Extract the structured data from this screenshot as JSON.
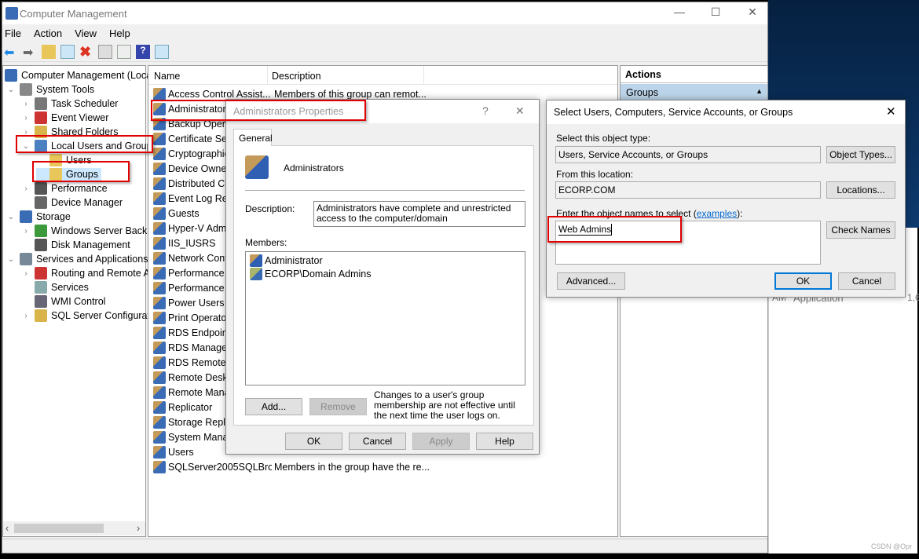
{
  "window": {
    "title": "Computer Management",
    "minimize": "—",
    "maximize": "☐",
    "close": "✕"
  },
  "menu": [
    "File",
    "Action",
    "View",
    "Help"
  ],
  "toolbar_icons": [
    "back-icon",
    "forward-icon",
    "up-folder-icon",
    "show-hide-tree-icon",
    "delete-icon",
    "properties-icon",
    "export-list-icon",
    "help-icon",
    "show-hide-action-pane-icon"
  ],
  "tree": [
    {
      "label": "Computer Management (Local",
      "level": 0,
      "expander": ""
    },
    {
      "label": "System Tools",
      "level": 1,
      "expander": "⌄"
    },
    {
      "label": "Task Scheduler",
      "level": 2,
      "expander": "›"
    },
    {
      "label": "Event Viewer",
      "level": 2,
      "expander": "›"
    },
    {
      "label": "Shared Folders",
      "level": 2,
      "expander": "›"
    },
    {
      "label": "Local Users and Groups",
      "level": 2,
      "expander": "⌄"
    },
    {
      "label": "Users",
      "level": 3,
      "expander": ""
    },
    {
      "label": "Groups",
      "level": 3,
      "expander": ""
    },
    {
      "label": "Performance",
      "level": 2,
      "expander": "›"
    },
    {
      "label": "Device Manager",
      "level": 2,
      "expander": ""
    },
    {
      "label": "Storage",
      "level": 1,
      "expander": "⌄"
    },
    {
      "label": "Windows Server Backup",
      "level": 2,
      "expander": "›"
    },
    {
      "label": "Disk Management",
      "level": 2,
      "expander": ""
    },
    {
      "label": "Services and Applications",
      "level": 1,
      "expander": "⌄"
    },
    {
      "label": "Routing and Remote Ac",
      "level": 2,
      "expander": "›"
    },
    {
      "label": "Services",
      "level": 2,
      "expander": ""
    },
    {
      "label": "WMI Control",
      "level": 2,
      "expander": ""
    },
    {
      "label": "SQL Server Configuratio",
      "level": 2,
      "expander": "›"
    }
  ],
  "list": {
    "columns": [
      "Name",
      "Description"
    ],
    "rows": [
      {
        "name": "Access Control Assist...",
        "desc": "Members of this group can remot..."
      },
      {
        "name": "Administrators",
        "desc": ""
      },
      {
        "name": "Backup Opera",
        "desc": ""
      },
      {
        "name": "Certificate Serv",
        "desc": ""
      },
      {
        "name": "Cryptographic",
        "desc": ""
      },
      {
        "name": "Device Owners",
        "desc": ""
      },
      {
        "name": "Distributed CO",
        "desc": ""
      },
      {
        "name": "Event Log Rea",
        "desc": ""
      },
      {
        "name": "Guests",
        "desc": ""
      },
      {
        "name": "Hyper-V Admi",
        "desc": ""
      },
      {
        "name": "IIS_IUSRS",
        "desc": ""
      },
      {
        "name": "Network Confi",
        "desc": ""
      },
      {
        "name": "Performance L",
        "desc": ""
      },
      {
        "name": "Performance M",
        "desc": ""
      },
      {
        "name": "Power Users",
        "desc": ""
      },
      {
        "name": "Print Operator",
        "desc": ""
      },
      {
        "name": "RDS Endpoint",
        "desc": ""
      },
      {
        "name": "RDS Managem",
        "desc": ""
      },
      {
        "name": "RDS Remote A",
        "desc": ""
      },
      {
        "name": "Remote Deskto",
        "desc": ""
      },
      {
        "name": "Remote Manag",
        "desc": ""
      },
      {
        "name": "Replicator",
        "desc": ""
      },
      {
        "name": "Storage Replic",
        "desc": ""
      },
      {
        "name": "System Manag",
        "desc": ""
      },
      {
        "name": "Users",
        "desc": ""
      },
      {
        "name": "SQLServer2005SQLBro...",
        "desc": "Members in the group have the re..."
      }
    ]
  },
  "actions": {
    "header": "Actions",
    "section": "Groups"
  },
  "background_window": {
    "col1": "AM",
    "col2": "Application",
    "col3": "1,6"
  },
  "properties_dialog": {
    "title": "Administrators Properties",
    "help": "?",
    "close": "✕",
    "tab": "General",
    "group_name": "Administrators",
    "description_label": "Description:",
    "description": "Administrators have complete and unrestricted access to the computer/domain",
    "members_label": "Members:",
    "members": [
      "Administrator",
      "ECORP\\Domain Admins"
    ],
    "add": "Add...",
    "remove": "Remove",
    "note": "Changes to a user's group membership are not effective until the next time the user logs on.",
    "ok": "OK",
    "cancel": "Cancel",
    "apply": "Apply",
    "help_btn": "Help"
  },
  "select_dialog": {
    "title": "Select Users, Computers, Service Accounts, or Groups",
    "close": "✕",
    "object_type_label": "Select this object type:",
    "object_type": "Users, Service Accounts, or Groups",
    "object_types_btn": "Object Types...",
    "location_label": "From this location:",
    "location": "ECORP.COM",
    "locations_btn": "Locations...",
    "names_label": "Enter the object names to select (",
    "names_link": "examples",
    "names_label_end": "):",
    "names_value": "Web Admins",
    "check_names": "Check Names",
    "advanced": "Advanced...",
    "ok": "OK",
    "cancel": "Cancel"
  },
  "watermark": "CSDN @Opr",
  "colors": {
    "highlight_red": "#e00000",
    "selected_row": "#cce8ff",
    "actions_section": "#bcd4ea",
    "link": "#0066cc"
  }
}
